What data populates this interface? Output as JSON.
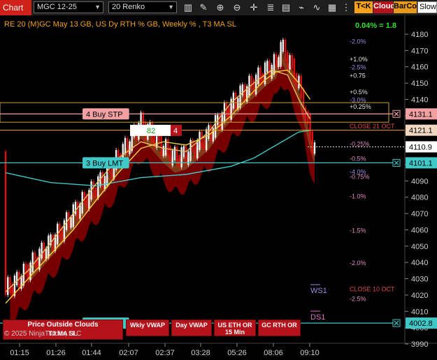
{
  "toolbar": {
    "chart_tab": "Chart",
    "instrument": "MGC 12-25",
    "bar_type": "20 Renko",
    "tk_label": "T<K",
    "cloud_label": "Cloud",
    "barcol_label": "BarCol",
    "slowm_label": "SlowM",
    "icons": [
      "bar-style-icon",
      "draw-tools-icon",
      "zoom-in-icon",
      "zoom-out-icon",
      "crosshair-icon",
      "properties-icon",
      "data-box-icon",
      "strategies-icon",
      "indicators-icon",
      "templates-icon"
    ]
  },
  "header": {
    "title": "RE 20  (M)GC May 13 GB, US Dy RTH % GB, Weekly % , T3 MA SL",
    "green_label": "0.04% = 1.8"
  },
  "levels": {
    "buy_stp": {
      "label": "4 Buy STP",
      "price": "4131.1"
    },
    "buy_lmt3": {
      "label": "3 Buy LMT",
      "price": "4101.1"
    },
    "buy_lmt1": {
      "label": "1 Buy LMT",
      "price": "4002.8"
    },
    "box_value": "82",
    "box_count": "4",
    "last_price": "4110.9",
    "orange_price": "4121.1"
  },
  "pct_labels": [
    {
      "text": "-2.0%",
      "price": 4176,
      "color": "#9b8ce8"
    },
    {
      "text": "+1.0%",
      "price": 4165,
      "color": "#e0e0e0"
    },
    {
      "text": "-2.5%",
      "price": 4160,
      "color": "#9b8ce8"
    },
    {
      "text": "+0.75",
      "price": 4155,
      "color": "#e0e0e0"
    },
    {
      "text": "+0.5%",
      "price": 4145,
      "color": "#e0e0e0"
    },
    {
      "text": "-3.0%",
      "price": 4140,
      "color": "#9b8ce8"
    },
    {
      "text": "+0.25%",
      "price": 4136,
      "color": "#e0e0e0"
    },
    {
      "text": "CLOSE 21 OCT",
      "price": 4124,
      "color": "#e04848"
    },
    {
      "text": "-0.25%",
      "price": 4113,
      "color": "#e08ac0"
    },
    {
      "text": "-0.5%",
      "price": 4104,
      "color": "#e08ac0"
    },
    {
      "text": "-4.0%",
      "price": 4096,
      "color": "#9b8ce8"
    },
    {
      "text": "-0.75%",
      "price": 4093,
      "color": "#e08ac0"
    },
    {
      "text": "-1.0%",
      "price": 4081,
      "color": "#e08ac0"
    },
    {
      "text": "-1.5%",
      "price": 4060,
      "color": "#e08ac0"
    },
    {
      "text": "-2.0%",
      "price": 4040,
      "color": "#e08ac0"
    },
    {
      "text": "CLOSE 10 OCT",
      "price": 4024,
      "color": "#e04848"
    },
    {
      "text": "-2.5%",
      "price": 4018,
      "color": "#e08ac0"
    }
  ],
  "ws_label": "WS1",
  "ds_label": "DS1",
  "bottom_buttons": {
    "price_outside": "Price Outside Clouds",
    "t3_ma_sl": "T3 MA SL",
    "wkly_vwap": "Wkly VWAP",
    "day_vwap": "Day VWAP",
    "us_eth_or": "US ETH OR 15 Min",
    "gc_rth_or": "GC RTH OR"
  },
  "copyright": "© 2025 NinjaTrader, LLC",
  "colors": {
    "teal": "#3ec8c8",
    "orange": "#e8a030",
    "cloud_red": "#8b0000",
    "ma_yellow": "#f0d040",
    "candle_white": "#f0f0f0",
    "candle_red": "#e01010"
  },
  "chart_data": {
    "type": "line",
    "title": "RE 20  (M)GC May 13 GB, US Dy RTH % GB, Weekly % , T3 MA SL",
    "y_axis": {
      "min": 3985,
      "max": 4185,
      "ticks": [
        3990,
        4000,
        4010,
        4020,
        4030,
        4040,
        4050,
        4060,
        4070,
        4080,
        4090,
        4100,
        4110,
        4120,
        4130,
        4140,
        4150,
        4160,
        4170,
        4180
      ]
    },
    "x_ticks": [
      "01:15",
      "01:26",
      "01:44",
      "02:07",
      "02:37",
      "03:28",
      "05:26",
      "08:06",
      "09:10"
    ],
    "series": [
      {
        "values": [
          [
            0,
            4023
          ],
          [
            5,
            4028
          ],
          [
            10,
            4036
          ],
          [
            15,
            4044
          ],
          [
            20,
            4052
          ],
          [
            25,
            4060
          ],
          [
            30,
            4070
          ],
          [
            35,
            4078
          ],
          [
            40,
            4086
          ],
          [
            45,
            4094
          ],
          [
            50,
            4104
          ],
          [
            55,
            4114
          ],
          [
            58,
            4122
          ],
          [
            60,
            4125
          ],
          [
            65,
            4118
          ],
          [
            70,
            4110
          ],
          [
            75,
            4104
          ],
          [
            80,
            4106
          ],
          [
            85,
            4112
          ],
          [
            90,
            4118
          ],
          [
            95,
            4128
          ],
          [
            100,
            4136
          ],
          [
            105,
            4144
          ],
          [
            110,
            4150
          ],
          [
            115,
            4157
          ],
          [
            120,
            4162
          ],
          [
            122,
            4172
          ],
          [
            125,
            4165
          ],
          [
            128,
            4156
          ],
          [
            130,
            4148
          ],
          [
            133,
            4130
          ],
          [
            135,
            4118
          ],
          [
            137,
            4109
          ]
        ]
      },
      {
        "values": [
          [
            0,
            4095
          ],
          [
            20,
            4089
          ],
          [
            40,
            4087
          ],
          [
            60,
            4092
          ],
          [
            80,
            4094
          ],
          [
            100,
            4099
          ],
          [
            110,
            4104
          ],
          [
            120,
            4112
          ],
          [
            130,
            4120
          ],
          [
            135,
            4121
          ]
        ]
      },
      {
        "values": [
          [
            0,
            4015
          ],
          [
            10,
            4030
          ],
          [
            20,
            4045
          ],
          [
            30,
            4060
          ],
          [
            40,
            4078
          ],
          [
            50,
            4095
          ],
          [
            60,
            4110
          ],
          [
            70,
            4114
          ],
          [
            80,
            4112
          ],
          [
            90,
            4118
          ],
          [
            100,
            4130
          ],
          [
            110,
            4145
          ],
          [
            115,
            4152
          ],
          [
            120,
            4157
          ],
          [
            125,
            4158
          ],
          [
            130,
            4150
          ],
          [
            135,
            4140
          ]
        ]
      },
      {
        "values": [
          [
            0,
            4022
          ],
          [
            10,
            4035
          ],
          [
            20,
            4052
          ],
          [
            30,
            4070
          ],
          [
            40,
            4088
          ],
          [
            50,
            4104
          ],
          [
            60,
            4114
          ],
          [
            70,
            4110
          ],
          [
            80,
            4108
          ],
          [
            90,
            4120
          ],
          [
            100,
            4138
          ],
          [
            110,
            4150
          ],
          [
            118,
            4158
          ],
          [
            125,
            4155
          ],
          [
            130,
            4140
          ],
          [
            135,
            4128
          ]
        ]
      }
    ]
  }
}
